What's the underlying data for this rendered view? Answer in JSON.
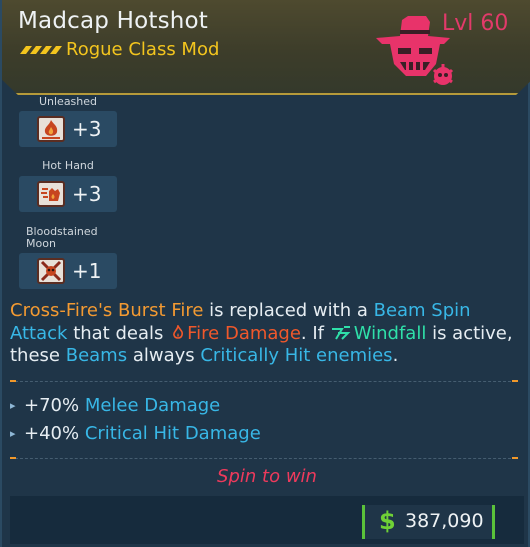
{
  "item": {
    "name": "Madcap Hotshot",
    "type": "Rogue Class Mod",
    "level": "Lvl 60",
    "rarity_color": "#f3c51e",
    "portrait_icon": "masked-rogue-portrait-icon"
  },
  "skills": [
    {
      "label": "Unleashed",
      "value": "+3",
      "icon": "flame-burst-icon"
    },
    {
      "label": "Hot Hand",
      "value": "+3",
      "icon": "flaming-hand-icon"
    },
    {
      "label": "Bloodstained Moon",
      "value": "+1",
      "icon": "crossed-blades-skull-icon"
    }
  ],
  "description": {
    "p1": "Cross-Fire's Burst Fire",
    "p2": " is replaced with a ",
    "p3": "Beam Spin Attack",
    "p4": " that deals ",
    "p5": "Fire Damage",
    "p6": ". If ",
    "p7": "Windfall",
    "p8": " is active, these ",
    "p9": "Beams",
    "p10": " always ",
    "p11": "Critically Hit enemies",
    "p12": "."
  },
  "stats": [
    {
      "value": "+70%",
      "name": "Melee Damage"
    },
    {
      "value": "+40%",
      "name": "Critical Hit Damage"
    }
  ],
  "flavor_text": "Spin to win",
  "price": {
    "currency_symbol": "$",
    "amount": "387,090"
  },
  "colors": {
    "level": "#e23a6a",
    "keyword_orange": "#f39a32",
    "keyword_blue": "#38b7e6",
    "keyword_green": "#2fe0a9",
    "flavor": "#ee3a5c",
    "money": "#6fd136"
  }
}
